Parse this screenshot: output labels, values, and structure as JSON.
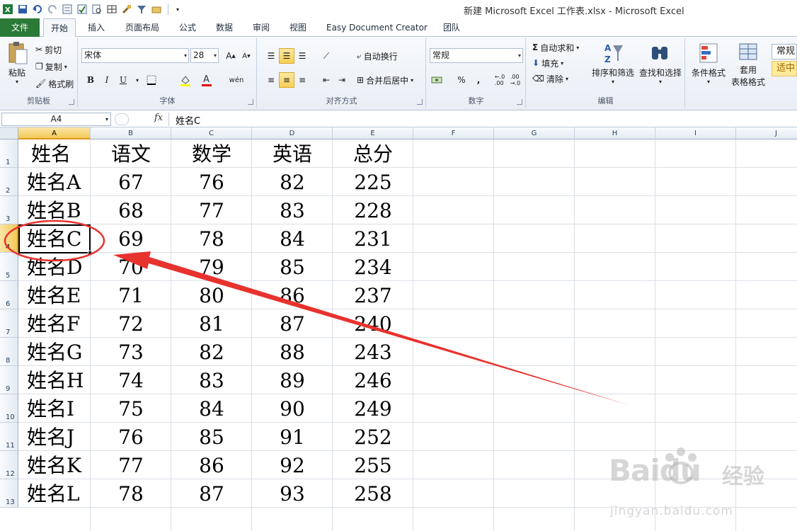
{
  "window": {
    "title": "新建 Microsoft Excel 工作表.xlsx - Microsoft Excel"
  },
  "tabs": [
    "文件",
    "开始",
    "插入",
    "页面布局",
    "公式",
    "数据",
    "审阅",
    "视图",
    "Easy Document Creator",
    "团队"
  ],
  "active_tab": "开始",
  "ribbon": {
    "clipboard": {
      "paste": "粘贴",
      "cut": "剪切",
      "copy": "复制",
      "format_painter": "格式刷",
      "label": "剪贴板"
    },
    "font": {
      "name": "宋体",
      "size": "28",
      "bold": "B",
      "italic": "I",
      "underline": "U",
      "label": "字体"
    },
    "alignment": {
      "wrap": "自动换行",
      "merge": "合并后居中",
      "label": "对齐方式"
    },
    "number": {
      "format": "常规",
      "percent": "%",
      "comma": ",",
      "label": "数字"
    },
    "editing": {
      "autosum": "自动求和",
      "fill": "填充",
      "clear": "清除",
      "sort_filter": "排序和筛选",
      "find_select": "查找和选择",
      "label": "编辑"
    },
    "styles": {
      "conditional": "条件格式",
      "table_format_1": "套用",
      "table_format_2": "表格格式",
      "style_normal": "常规",
      "style_neutral": "适中"
    }
  },
  "formula_bar": {
    "name_box": "A4",
    "fx": "fx",
    "content": "姓名C"
  },
  "columns": [
    "A",
    "B",
    "C",
    "D",
    "E",
    "F",
    "G",
    "H",
    "I",
    "J"
  ],
  "rows": [
    "1",
    "2",
    "3",
    "4",
    "5",
    "6",
    "7",
    "8",
    "9",
    "10",
    "11",
    "12",
    "13"
  ],
  "selected_cell": "A4",
  "table": {
    "headers": [
      "姓名",
      "语文",
      "数学",
      "英语",
      "总分"
    ],
    "rows": [
      [
        "姓名A",
        "67",
        "76",
        "82",
        "225"
      ],
      [
        "姓名B",
        "68",
        "77",
        "83",
        "228"
      ],
      [
        "姓名C",
        "69",
        "78",
        "84",
        "231"
      ],
      [
        "姓名D",
        "70",
        "79",
        "85",
        "234"
      ],
      [
        "姓名E",
        "71",
        "80",
        "86",
        "237"
      ],
      [
        "姓名F",
        "72",
        "81",
        "87",
        "240"
      ],
      [
        "姓名G",
        "73",
        "82",
        "88",
        "243"
      ],
      [
        "姓名H",
        "74",
        "83",
        "89",
        "246"
      ],
      [
        "姓名I",
        "75",
        "84",
        "90",
        "249"
      ],
      [
        "姓名J",
        "76",
        "85",
        "91",
        "252"
      ],
      [
        "姓名K",
        "77",
        "86",
        "92",
        "255"
      ],
      [
        "姓名L",
        "78",
        "87",
        "93",
        "258"
      ]
    ]
  },
  "annotation": {
    "color": "#e8322e"
  },
  "watermark": {
    "brand": "Baidu",
    "cn": "经验",
    "url": "jingyan.baidu.com"
  },
  "colors": {
    "file_tab": "#2b7a37",
    "selection_header": "#f4c959"
  }
}
